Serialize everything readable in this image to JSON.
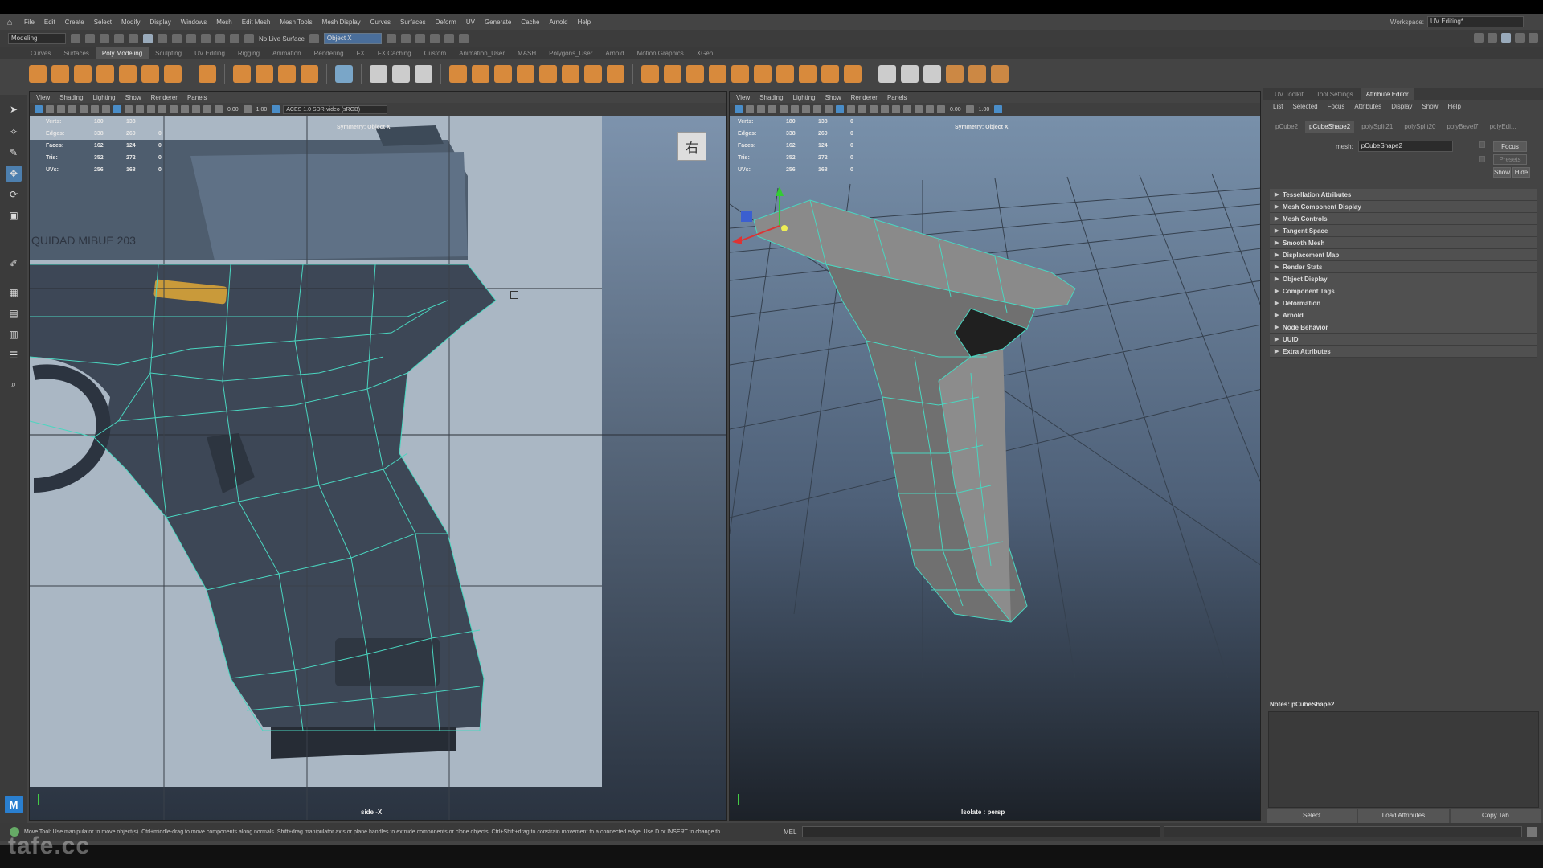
{
  "menubar": {
    "items": [
      "File",
      "Edit",
      "Create",
      "Select",
      "Modify",
      "Display",
      "Windows",
      "Mesh",
      "Edit Mesh",
      "Mesh Tools",
      "Mesh Display",
      "Curves",
      "Surfaces",
      "Deform",
      "UV",
      "Generate",
      "Cache",
      "Arnold",
      "Help"
    ],
    "workspace_label": "Workspace:",
    "workspace_value": "UV Editing*"
  },
  "statusline": {
    "mode": "Modeling",
    "live_surface": "No Live Surface",
    "symmetry_field": "Object X"
  },
  "shelf_tabs": {
    "items": [
      "Curves",
      "Surfaces",
      "Poly Modeling",
      "Sculpting",
      "UV Editing",
      "Rigging",
      "Animation",
      "Rendering",
      "FX",
      "FX Caching",
      "Custom",
      "Animation_User",
      "MASH",
      "Polygons_User",
      "Arnold",
      "Motion Graphics",
      "XGen"
    ],
    "active_index": 2
  },
  "viewport_menu": [
    "View",
    "Shading",
    "Lighting",
    "Show",
    "Renderer",
    "Panels"
  ],
  "viewport_left": {
    "exposure": "0.00",
    "gamma": "1.00",
    "color_space": "ACES 1.0 SDR-video (sRGB)",
    "hud": [
      {
        "label": "Verts:",
        "a": "180",
        "b": "138",
        "c": ""
      },
      {
        "label": "Edges:",
        "a": "338",
        "b": "260",
        "c": "0"
      },
      {
        "label": "Faces:",
        "a": "162",
        "b": "124",
        "c": "0"
      },
      {
        "label": "Tris:",
        "a": "352",
        "b": "272",
        "c": "0"
      },
      {
        "label": "UVs:",
        "a": "256",
        "b": "168",
        "c": "0"
      }
    ],
    "symmetry": "Symmetry: Object X",
    "camera": "side -X",
    "view_icon_glyph": "右",
    "gun_text": "QUIDAD MIBUE 203"
  },
  "viewport_right": {
    "exposure": "0.00",
    "gamma": "1.00",
    "hud": [
      {
        "label": "Verts:",
        "a": "180",
        "b": "138",
        "c": "0"
      },
      {
        "label": "Edges:",
        "a": "338",
        "b": "260",
        "c": "0"
      },
      {
        "label": "Faces:",
        "a": "162",
        "b": "124",
        "c": "0"
      },
      {
        "label": "Tris:",
        "a": "352",
        "b": "272",
        "c": "0"
      },
      {
        "label": "UVs:",
        "a": "256",
        "b": "168",
        "c": "0"
      }
    ],
    "symmetry": "Symmetry: Object X",
    "camera": "Isolate : persp"
  },
  "attribute_editor": {
    "tabs": [
      "UV Toolkit",
      "Tool Settings",
      "Attribute Editor"
    ],
    "active_tab_index": 2,
    "menu": [
      "List",
      "Selected",
      "Focus",
      "Attributes",
      "Display",
      "Show",
      "Help"
    ],
    "nodes": [
      "pCube2",
      "pCubeShape2",
      "polySplit21",
      "polySplit20",
      "polyBevel7",
      "polyEdi..."
    ],
    "active_node_index": 1,
    "mesh_label": "mesh:",
    "mesh_value": "pCubeShape2",
    "focus_button": "Focus",
    "presets_button": "Presets",
    "show_button": "Show",
    "hide_button": "Hide",
    "sections": [
      "Tessellation Attributes",
      "Mesh Component Display",
      "Mesh Controls",
      "Tangent Space",
      "Smooth Mesh",
      "Displacement Map",
      "Render Stats",
      "Object Display",
      "Component Tags",
      "Deformation",
      "Arnold",
      "Node Behavior",
      "UUID",
      "Extra Attributes"
    ],
    "notes_label": "Notes: pCubeShape2",
    "bottom_buttons": [
      "Select",
      "Load Attributes",
      "Copy Tab"
    ]
  },
  "helpline": {
    "text": "Move Tool: Use manipulator to move object(s). Ctrl+middle-drag to move components along normals. Shift+drag manipulator axis or plane handles to extrude components or clone objects. Ctrl+Shift+drag to constrain movement to a connected edge. Use D or INSERT to change th",
    "mel_label": "MEL"
  },
  "watermark": "tafe.cc",
  "colors": {
    "accent": "#4a8dc8",
    "wireframe": "#4ad6c0",
    "reference_bg": "#a9b6c4"
  }
}
